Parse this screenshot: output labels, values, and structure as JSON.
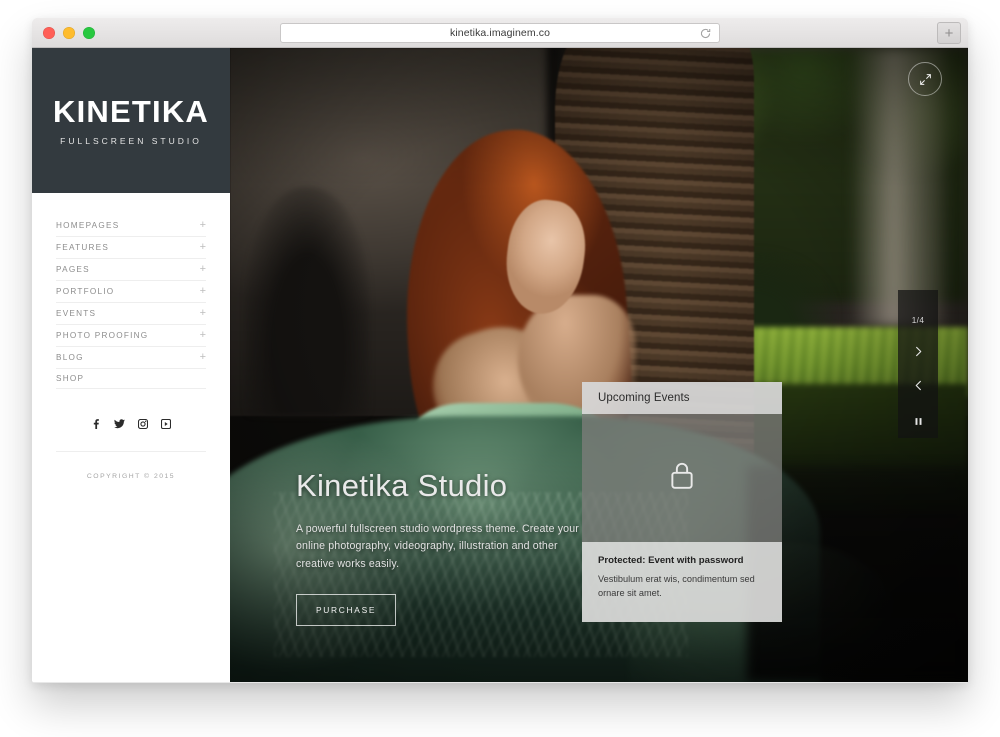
{
  "browser": {
    "url": "kinetika.imaginem.co",
    "reload_icon": "reload-icon",
    "new_tab_label": "+",
    "traffic_lights": [
      "close",
      "minimize",
      "zoom"
    ]
  },
  "sidebar": {
    "brand": {
      "name": "KINETIKA",
      "tagline": "FULLSCREEN STUDIO"
    },
    "menu": [
      {
        "label": "HOMEPAGES",
        "expander": "+"
      },
      {
        "label": "FEATURES",
        "expander": "+"
      },
      {
        "label": "PAGES",
        "expander": "+"
      },
      {
        "label": "PORTFOLIO",
        "expander": "+"
      },
      {
        "label": "EVENTS",
        "expander": "+"
      },
      {
        "label": "PHOTO PROOFING",
        "expander": "+"
      },
      {
        "label": "BLOG",
        "expander": "+"
      },
      {
        "label": "SHOP",
        "expander": ""
      }
    ],
    "social": [
      {
        "name": "facebook-icon"
      },
      {
        "name": "twitter-icon"
      },
      {
        "name": "instagram-icon"
      },
      {
        "name": "vimeo-icon"
      }
    ],
    "copyright": "COPYRIGHT © 2015"
  },
  "hero": {
    "heading": "Kinetika Studio",
    "paragraph": "A powerful fullscreen studio wordpress theme. Create your online photography, videography, illustration and other creative works easily.",
    "cta_label": "PURCHASE",
    "expand_icon": "expand-fullscreen-icon"
  },
  "events_card": {
    "header": "Upcoming Events",
    "thumb_icon": "lock-icon",
    "title": "Protected: Event with password",
    "description": "Vestibulum erat wis, condimentum sed ornare sit amet."
  },
  "slider": {
    "counter": "1/4",
    "next_icon": "chevron-right-icon",
    "prev_icon": "chevron-left-icon",
    "pause_icon": "pause-icon"
  },
  "colors": {
    "brand_block": "#333a3f",
    "sidebar_bg": "#ffffff",
    "menu_text": "#8d8d8d",
    "card_header": "#d6d6d6",
    "card_body": "#dddddb",
    "accent_green": "#2c5040"
  }
}
